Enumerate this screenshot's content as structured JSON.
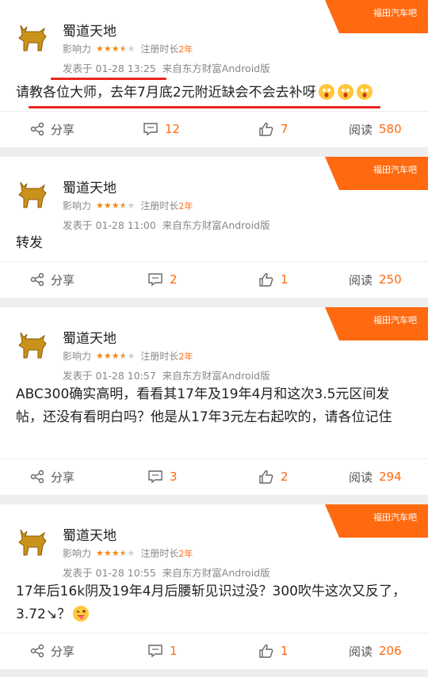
{
  "colors": {
    "accent": "#ff6a10",
    "annotation": "#e8261c",
    "star": "#f08a13"
  },
  "labels": {
    "influence": "影响力",
    "reg_time": "注册时长",
    "share": "分享",
    "read": "阅读"
  },
  "posts": [
    {
      "tag": "福田汽车吧",
      "username": "蜀道天地",
      "rating": 3.5,
      "reg_years": "2年",
      "date_prefix": "发表于",
      "date": "01-28 13:25",
      "source": "来自东方财富Android版",
      "content": "请教各位大师，去年7月底2元附近缺会不会去补呀",
      "emojis": [
        "surprised-emoji",
        "surprised-emoji",
        "surprised-emoji"
      ],
      "comments": "12",
      "likes": "7",
      "reads": "580"
    },
    {
      "tag": "福田汽车吧",
      "username": "蜀道天地",
      "rating": 3.5,
      "reg_years": "2年",
      "date_prefix": "发表于",
      "date": "01-28 11:00",
      "source": "来自东方财富Android版",
      "content": "转发",
      "emojis": [],
      "comments": "2",
      "likes": "1",
      "reads": "250"
    },
    {
      "tag": "福田汽车吧",
      "username": "蜀道天地",
      "rating": 3.5,
      "reg_years": "2年",
      "date_prefix": "发表于",
      "date": "01-28 10:57",
      "source": "来自东方财富Android版",
      "content": "ABC300确实高明，看看其17年及19年4月和这次3.5元区间发帖，还没有看明白吗？他是从17年3元左右起吹的，请各位记住",
      "emojis": [],
      "comments": "3",
      "likes": "2",
      "reads": "294"
    },
    {
      "tag": "福田汽车吧",
      "username": "蜀道天地",
      "rating": 3.5,
      "reg_years": "2年",
      "date_prefix": "发表于",
      "date": "01-28 10:55",
      "source": "来自东方财富Android版",
      "content": "17年后16k阴及19年4月后腰斩见识过没？300吹牛这次又反了，3.72↘？",
      "emojis": [
        "tongue-emoji"
      ],
      "comments": "1",
      "likes": "1",
      "reads": "206"
    }
  ]
}
